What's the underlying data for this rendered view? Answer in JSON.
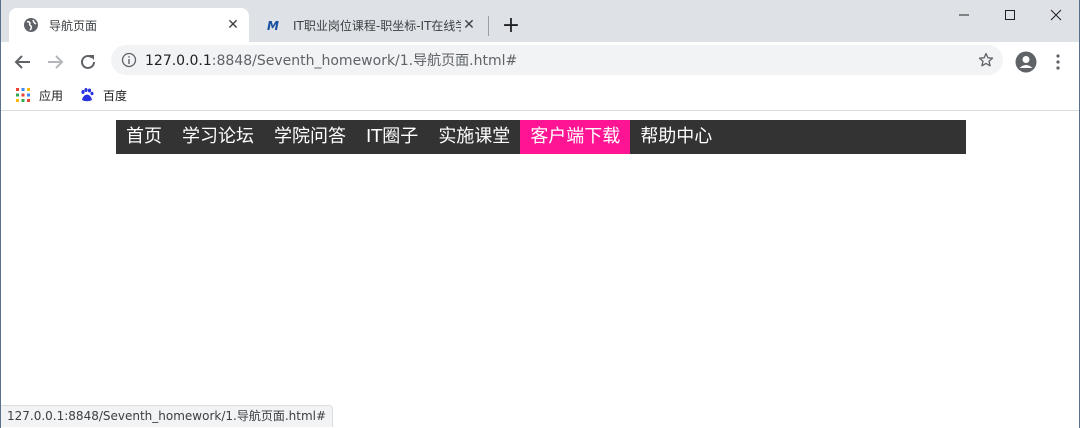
{
  "tabs": [
    {
      "title": "导航页面",
      "icon": "globe-icon",
      "active": true
    },
    {
      "title": "IT职业岗位课程-职坐标-IT在线学",
      "icon": "zhizuobiao-logo-icon",
      "active": false
    }
  ],
  "window_controls": {
    "minimize": "minimize-icon",
    "maximize": "maximize-icon",
    "close": "close-icon"
  },
  "address_bar": {
    "host": "127.0.0.1",
    "path": ":8848/Seventh_homework/1.导航页面.html#"
  },
  "bookmarks": [
    {
      "label": "应用",
      "icon": "apps-grid-icon"
    },
    {
      "label": "百度",
      "icon": "baidu-paw-icon"
    }
  ],
  "nav": {
    "items": [
      {
        "label": "首页",
        "active": false
      },
      {
        "label": "学习论坛",
        "active": false
      },
      {
        "label": "学院问答",
        "active": false
      },
      {
        "label": "IT圈子",
        "active": false
      },
      {
        "label": "实施课堂",
        "active": false
      },
      {
        "label": "客户端下载",
        "active": true
      },
      {
        "label": "帮助中心",
        "active": false
      }
    ],
    "bg_color": "#333333",
    "active_color": "#ff1493",
    "text_color": "#ffffff"
  },
  "status_bar": {
    "text": "127.0.0.1:8848/Seventh_homework/1.导航页面.html#"
  }
}
